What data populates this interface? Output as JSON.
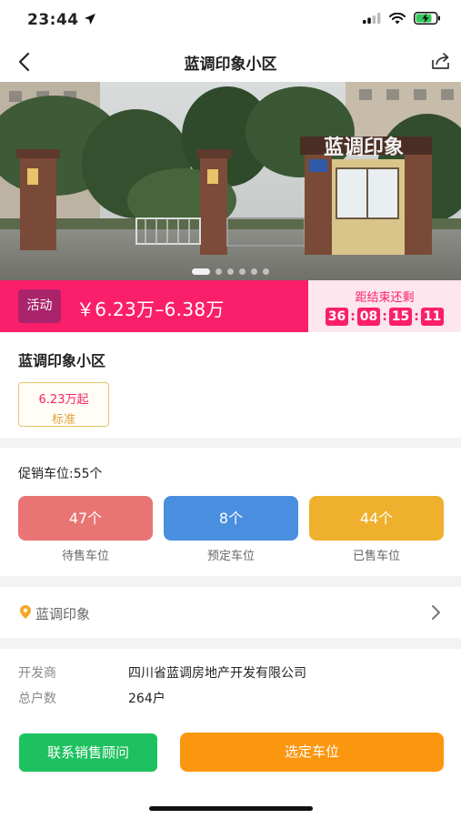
{
  "status_bar": {
    "time": "23:44",
    "icons": [
      "location-arrow-icon",
      "signal-icon",
      "wifi-icon",
      "battery-charging-icon"
    ]
  },
  "nav": {
    "title": "蓝调印象小区",
    "back_icon": "chevron-left-icon",
    "share_icon": "share-icon"
  },
  "hero": {
    "gate_sign": "蓝调印象",
    "carousel_count": 6,
    "carousel_active": 0
  },
  "promo": {
    "tag": "活动",
    "price_range": "￥6.23万–6.38万",
    "countdown_label": "距结束还剩",
    "countdown": [
      "36",
      "08",
      "15",
      "11"
    ],
    "accent_color": "#fb1f6b"
  },
  "community": {
    "name": "蓝调印象小区",
    "chip_price": "6.23万起",
    "chip_label": "标准"
  },
  "parking": {
    "promo_count_label": "促销车位:55个",
    "stats": [
      {
        "value": "47个",
        "label": "待售车位",
        "color": "#e97474"
      },
      {
        "value": "8个",
        "label": "预定车位",
        "color": "#4a8ee0"
      },
      {
        "value": "44个",
        "label": "已售车位",
        "color": "#efb02e"
      }
    ]
  },
  "location": {
    "name": "蓝调印象",
    "pin_icon": "location-pin-icon",
    "chevron_icon": "chevron-right-icon"
  },
  "info": {
    "rows": [
      {
        "key": "开发商",
        "value": "四川省蓝调房地产开发有限公司"
      },
      {
        "key": "总户数",
        "value": "264户"
      }
    ]
  },
  "actions": {
    "contact": "联系销售顾问",
    "select": "选定车位"
  }
}
